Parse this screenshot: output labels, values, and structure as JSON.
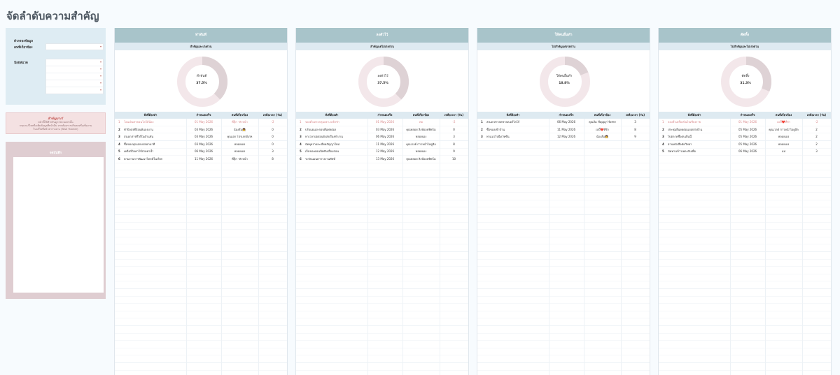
{
  "page_title": "จัดลำดับความสำคัญ",
  "filter": {
    "title": "ตัวกรองข้อมูล",
    "person_label": "คนที่เกี่ยวข้อง",
    "status_label": "น้อยหมวด"
  },
  "note": {
    "title": "สำคัญมาก!",
    "lines": [
      "หน้านี้ใช้สำหรับดูภาพรวมเท่านั้น",
      "กรุณาแก้ไขหรือเพิ่มข้อมูลที่หน้าอื่น หากต้องการปรับลดหรือเพิ่มงาน",
      "ไปแก้ไขที่หน้าตารางงาน (Task Tracker)"
    ]
  },
  "memo": {
    "title": "จดบันทึก"
  },
  "table_headers": {
    "name": "สิ่งที่ต้องทำ",
    "date": "กำหนดเสร็จ",
    "person": "คนที่เกี่ยวข้อง",
    "days": "เหลือเวลา (วัน)"
  },
  "columns": [
    {
      "title": "ทำทันที",
      "subtitle": "สำคัญและเร่งด่วน",
      "center_label": "ทำทันที",
      "percent": "37.5%",
      "fraction": 0.375,
      "tasks": [
        {
          "no": "1",
          "name": "โอนเงินค่าคอนโดให้น้อง",
          "date": "01 May 2026",
          "person": "พี่ปุ๊ก ·หัวหน้า",
          "days": "-2",
          "overdue": true
        },
        {
          "no": "2",
          "name": "ทำบิลส่งที่ถ้อนค้นลงบาน",
          "date": "03 May 2026",
          "person": "น้องส้ม👧",
          "days": "0",
          "overdue": false
        },
        {
          "no": "3",
          "name": "ส่งเอกสารที่ได้ในตำแหัน",
          "date": "03 May 2026",
          "person": "คุณเอก โปรเจกต์เก่ห",
          "days": "0",
          "overdue": false
        },
        {
          "no": "4",
          "name": "ซื้อของทุกแสดงปลอกนาที",
          "date": "03 May 2026",
          "person": "พลอยเอง",
          "days": "0",
          "overdue": false
        },
        {
          "no": "5",
          "name": "เคลียร์บิลค่าใช้จ่ายค่าน้ำ",
          "date": "06 May 2026",
          "person": "พลอยเอง",
          "days": "3",
          "overdue": false
        },
        {
          "no": "6",
          "name": "ตามงานการพัฒนาไคลพ์ในเวียก",
          "date": "11 May 2026",
          "person": "พี่ปุ๊ก ·หัวหน้า",
          "days": "8",
          "overdue": false
        }
      ]
    },
    {
      "title": "ลงตัวไว้",
      "subtitle": "สำคัญแต่ไม่เร่งด่วน",
      "center_label": "ลงตัวไว้",
      "percent": "37.5%",
      "fraction": 0.375,
      "tasks": [
        {
          "no": "1",
          "name": "จองตั๋วเดรงกลุ่มเพาเวอร์ตรัก",
          "date": "01 May 2026",
          "person": "ต่อ",
          "days": "-2",
          "overdue": true
        },
        {
          "no": "2",
          "name": "ปรับแผนปะกอบพี่แท่ดฝ่อง",
          "date": "03 May 2026",
          "person": "คุณพลอย สิงห์ออฟฟิศโม",
          "days": "0",
          "overdue": false
        },
        {
          "no": "3",
          "name": "หาเวลาฝอสอนยังส่งเรื่องทำงาน",
          "date": "06 May 2026",
          "person": "พลอยเอง",
          "days": "3",
          "overdue": false
        },
        {
          "no": "4",
          "name": "นัดคุยรายละเอียดสัญญาใหม่",
          "date": "11 May 2026",
          "person": "คุณเวลย์ ก่าวหน้าไอดูฮิล",
          "days": "8",
          "overdue": false
        },
        {
          "no": "5",
          "name": "เก็บของดอนนิทซับเสื่อมก่อน",
          "date": "12 May 2026",
          "person": "พลอยเอง",
          "days": "9",
          "overdue": false
        },
        {
          "no": "6",
          "name": "ระบับแผนตารางงานศัพท์",
          "date": "13 May 2026",
          "person": "คุณพลอย สิงห์ออฟฟิศโม",
          "days": "10",
          "overdue": false
        }
      ]
    },
    {
      "title": "ให้คนอื่นทำ",
      "subtitle": "ไม่สำคัญแต่เร่งด่วน",
      "center_label": "ให้คนอื่นทำ",
      "percent": "18.8%",
      "fraction": 0.188,
      "tasks": [
        {
          "no": "1",
          "name": "ส่งเอกสารลดชายเบอร์ไลโก้",
          "date": "06 May 2026",
          "person": "คุณส้ม Happy Home",
          "days": "3",
          "overdue": false
        },
        {
          "no": "2",
          "name": "ซื้อของเข้าบ้าน",
          "date": "11 May 2026",
          "person": "เบบี้❤️ที่รัก",
          "days": "8",
          "overdue": false
        },
        {
          "no": "3",
          "name": "พาแมวไปฉีดวัคซีน",
          "date": "12 May 2026",
          "person": "น้องส้ม👧",
          "days": "9",
          "overdue": false
        }
      ]
    },
    {
      "title": "ตัดทิ้ง",
      "subtitle": "ไม่สำคัญและไม่เร่งด่วน",
      "center_label": "ตัดทิ้ง",
      "percent": "31.3%",
      "fraction": 0.313,
      "tasks": [
        {
          "no": "1",
          "name": "จองตั๋วเครื่องบินไปเชียงราย",
          "date": "01 May 2026",
          "person": "เบบี้❤️ที่รัก",
          "days": "-2",
          "overdue": true
        },
        {
          "no": "2",
          "name": "ประชุมยืนยดตอนบอกส่งบ้าน",
          "date": "05 May 2026",
          "person": "คุณเวลย์ ก่าวหน้าไอดูฮิล",
          "days": "2",
          "overdue": false
        },
        {
          "no": "3",
          "name": "ไปตลาดซื้อตบเย็นนี้",
          "date": "05 May 2026",
          "person": "พลอยเอง",
          "days": "2",
          "overdue": false
        },
        {
          "no": "4",
          "name": "อ่านหนังสือคัดวิทยา",
          "date": "05 May 2026",
          "person": "พลอยเอง",
          "days": "2",
          "overdue": false
        },
        {
          "no": "5",
          "name": "นัดทานข้าวเพลงกับเพื่อ",
          "date": "06 May 2026",
          "person": "แม่",
          "days": "3",
          "overdue": false
        }
      ]
    }
  ]
}
